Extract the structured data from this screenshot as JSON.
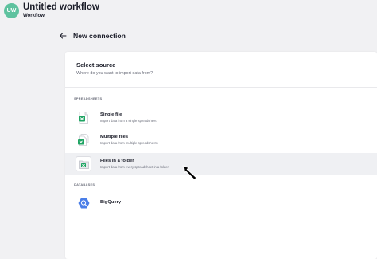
{
  "app": {
    "avatar_initials": "UW",
    "title": "Untitled workflow",
    "subtitle": "Workflow"
  },
  "header": {
    "back_icon": "arrow-left-icon",
    "title": "New connection"
  },
  "panel": {
    "title": "Select source",
    "subtitle": "Where do you want to import data from?"
  },
  "sections": {
    "spreadsheets_label": "SPREADSHEETS",
    "databases_label": "DATABASES"
  },
  "items": [
    {
      "label": "Single file",
      "description": "Import data from a single spreadsheet",
      "icon": "spreadsheet-file-icon"
    },
    {
      "label": "Multiple files",
      "description": "Import data from multiple spreadsheets",
      "icon": "multiple-spreadsheets-icon"
    },
    {
      "label": "Files in a folder",
      "description": "Import data from every spreadsheet in a folder",
      "icon": "folder-spreadsheets-icon",
      "active": true
    },
    {
      "label": "BigQuery",
      "description": "",
      "icon": "bigquery-icon"
    }
  ],
  "colors": {
    "avatar": "#5ec29f",
    "sheet_green": "#1fa463",
    "bigquery_blue": "#4a7ee8",
    "active_row": "#eff0f3"
  }
}
